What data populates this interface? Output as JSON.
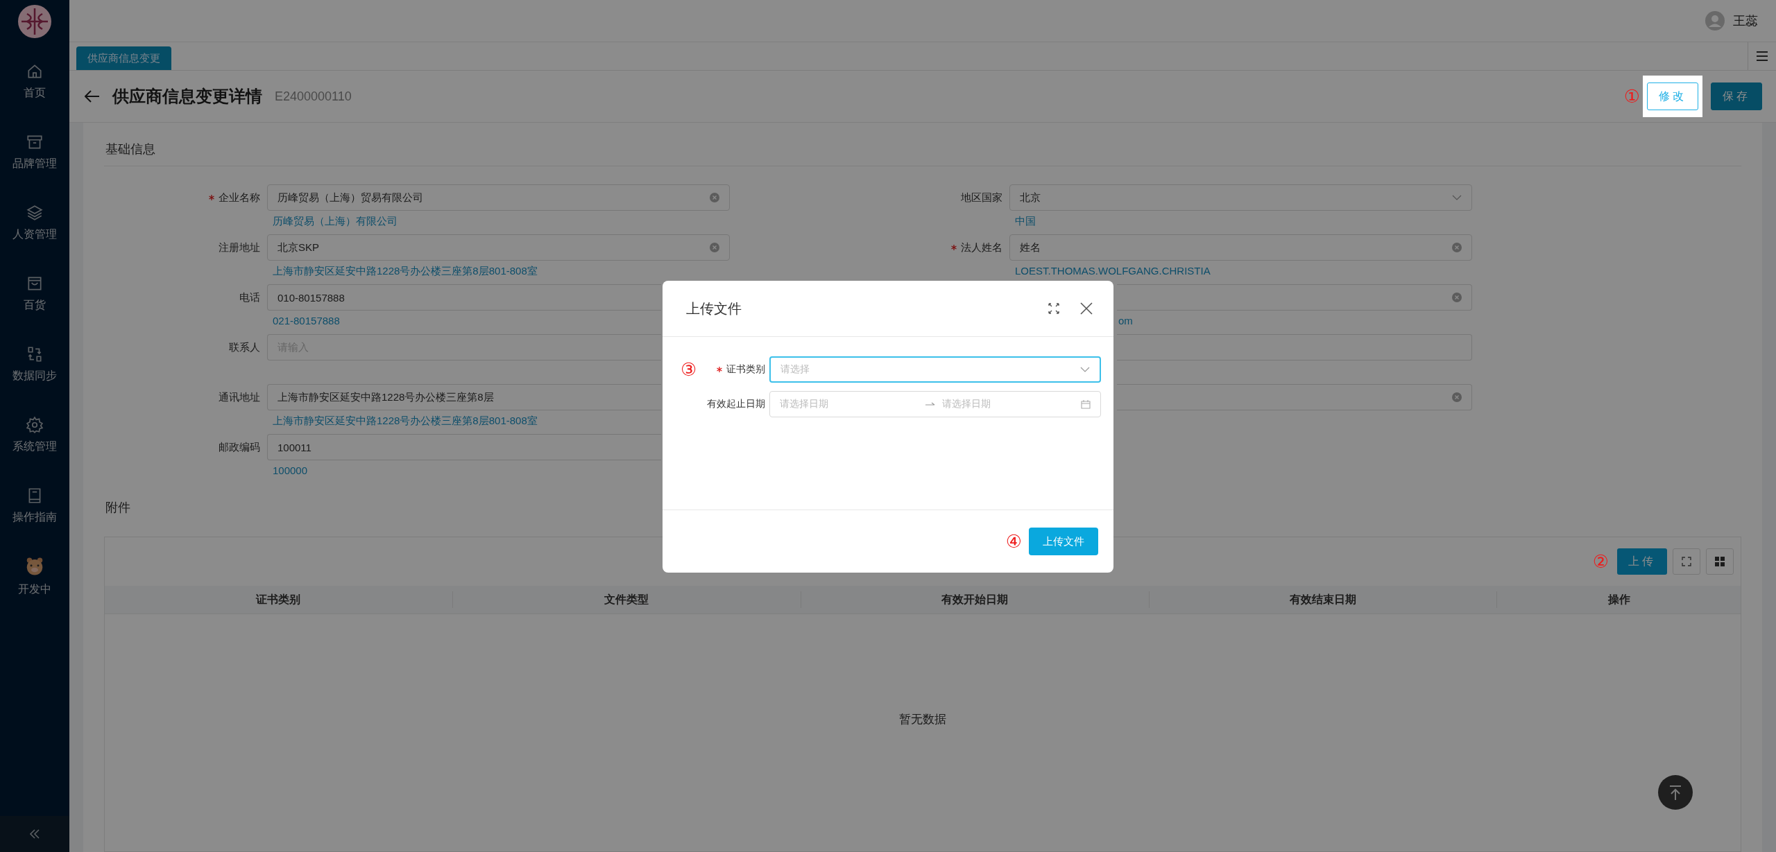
{
  "sidebar": {
    "items": [
      {
        "label": "首页",
        "selected": false
      },
      {
        "label": "品牌管理",
        "selected": false
      },
      {
        "label": "人资管理",
        "selected": false
      },
      {
        "label": "百货",
        "selected": false
      },
      {
        "label": "数据同步",
        "selected": false
      },
      {
        "label": "系统管理",
        "selected": false
      },
      {
        "label": "操作指南",
        "selected": false
      },
      {
        "label": "开发中",
        "selected": false
      }
    ]
  },
  "header": {
    "user": "王蕊"
  },
  "tabs": [
    {
      "label": "供应商信息变更",
      "selected": true
    }
  ],
  "page": {
    "title": "供应商信息变更详情",
    "code": "E2400000110",
    "buttons": [
      {
        "label": "修改",
        "kind": "outline",
        "highlight": true,
        "annotation": "①"
      },
      {
        "label": "保存",
        "kind": "primary",
        "highlight": false
      }
    ]
  },
  "basic": {
    "title": "基础信息",
    "left_fields": [
      {
        "label": "企业名称",
        "required": true,
        "kind": "input",
        "value": "历峰贸易（上海）贸易有限公司",
        "clearable": true,
        "hint": "历峰贸易（上海）有限公司"
      },
      {
        "label": "注册地址",
        "required": false,
        "kind": "input",
        "value": "北京SKP",
        "clearable": true,
        "hint": "上海市静安区延安中路1228号办公楼三座第8层801-808室"
      },
      {
        "label": "电话",
        "required": false,
        "kind": "input",
        "value": "010-80157888",
        "clearable": false,
        "hint": "021-80157888"
      },
      {
        "label": "联系人",
        "required": false,
        "kind": "input",
        "placeholder": "请输入",
        "clearable": false
      },
      {
        "label": "通讯地址",
        "required": false,
        "kind": "input",
        "value": "上海市静安区延安中路1228号办公楼三座第8层",
        "clearable": false,
        "hint": "上海市静安区延安中路1228号办公楼三座第8层801-808室"
      },
      {
        "label": "邮政编码",
        "required": false,
        "kind": "input",
        "value": "100011",
        "clearable": false,
        "hint": "100000"
      }
    ],
    "right_fields": [
      {
        "label": "地区国家",
        "required": false,
        "kind": "select",
        "value": "北京",
        "clearable": false,
        "hint": "中国"
      },
      {
        "label": "法人姓名",
        "required": true,
        "kind": "input",
        "value": "姓名",
        "clearable": true,
        "hint": "LOEST.THOMAS.WOLFGANG.CHRISTIA"
      },
      {
        "required": false,
        "kind": "input",
        "clearable": true,
        "hint": "om"
      },
      {
        "required": false,
        "kind": "input",
        "clearable": false
      },
      {
        "required": false,
        "kind": "input",
        "clearable": true
      }
    ]
  },
  "attachments": {
    "title": "附件",
    "upload_button": {
      "label": "上传",
      "annotation": "②"
    },
    "columns": [
      "证书类别",
      "文件类型",
      "有效开始日期",
      "有效结束日期",
      "操作"
    ],
    "empty_text": "暂无数据"
  },
  "modal": {
    "title": "上传文件",
    "fields": [
      {
        "label": "证书类别",
        "required": true,
        "kind": "select",
        "placeholder": "请选择",
        "focused": true,
        "annotation": "③"
      },
      {
        "label": "有效起止日期",
        "required": false,
        "kind": "daterange",
        "start_placeholder": "请选择日期",
        "end_placeholder": "请选择日期",
        "focused": false
      }
    ],
    "submit": {
      "label": "上传文件",
      "annotation": "④"
    }
  }
}
